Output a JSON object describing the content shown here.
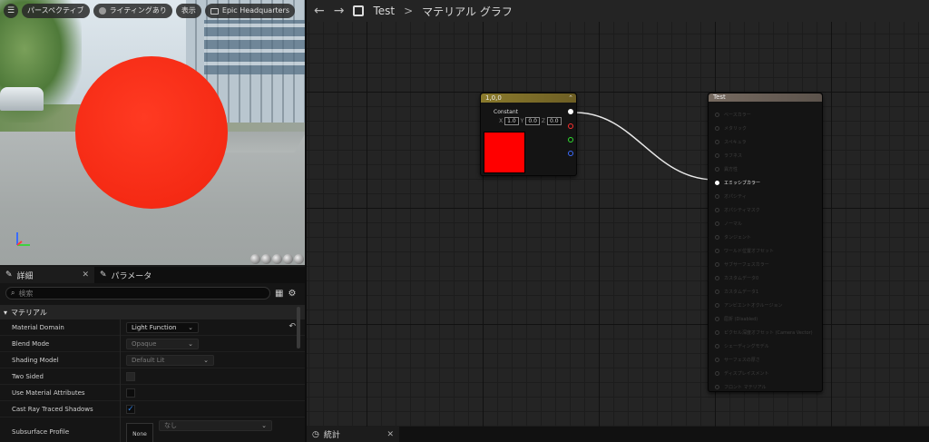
{
  "viewport": {
    "menu_icon": "hamburger-icon",
    "perspective_label": "パースペクティブ",
    "lighting_label": "ライティングあり",
    "show_label": "表示",
    "environment_label": "Epic Headquarters"
  },
  "details": {
    "tab_details": "詳細",
    "tab_parameters": "パラメータ",
    "search_placeholder": "検索",
    "section_title": "マテリアル",
    "props": {
      "material_domain_label": "Material Domain",
      "material_domain_value": "Light Function",
      "blend_mode_label": "Blend Mode",
      "blend_mode_value": "Opaque",
      "shading_model_label": "Shading Model",
      "shading_model_value": "Default Lit",
      "two_sided_label": "Two Sided",
      "use_material_attributes_label": "Use Material Attributes",
      "cast_ray_traced_shadows_label": "Cast Ray Traced Shadows",
      "subsurface_profile_label": "Subsurface Profile",
      "subsurface_profile_value": "なし",
      "thumbnail_label": "None"
    }
  },
  "graph": {
    "breadcrumb_asset": "Test",
    "breadcrumb_separator": ">",
    "breadcrumb_graph": "マテリアル グラフ",
    "constant_node": {
      "title": "1,0,0",
      "label": "Constant",
      "x_label": "X",
      "x_value": "1.0",
      "y_label": "Y",
      "y_value": "0.0",
      "z_label": "Z",
      "z_value": "0.0",
      "color": "#ff0000"
    },
    "output_node": {
      "title": "Test",
      "inputs": [
        "ベースカラー",
        "メタリック",
        "スペキュラ",
        "ラフネス",
        "異方性",
        "エミッシブカラー",
        "オパシティ",
        "オパシティマスク",
        "ノーマル",
        "タンジェント",
        "ワールド位置オフセット",
        "サブサーフェスカラー",
        "カスタムデータ0",
        "カスタムデータ1",
        "アンビエントオクルージョン",
        "屈折 (Disabled)",
        "ピクセル深度オフセット (Camera Vector)",
        "シェーディングモデル",
        "サーフェスの厚さ",
        "ディスプレイスメント",
        "フロント マテリアル"
      ],
      "connected_index": 5
    }
  },
  "stats": {
    "tab_label": "統計"
  }
}
